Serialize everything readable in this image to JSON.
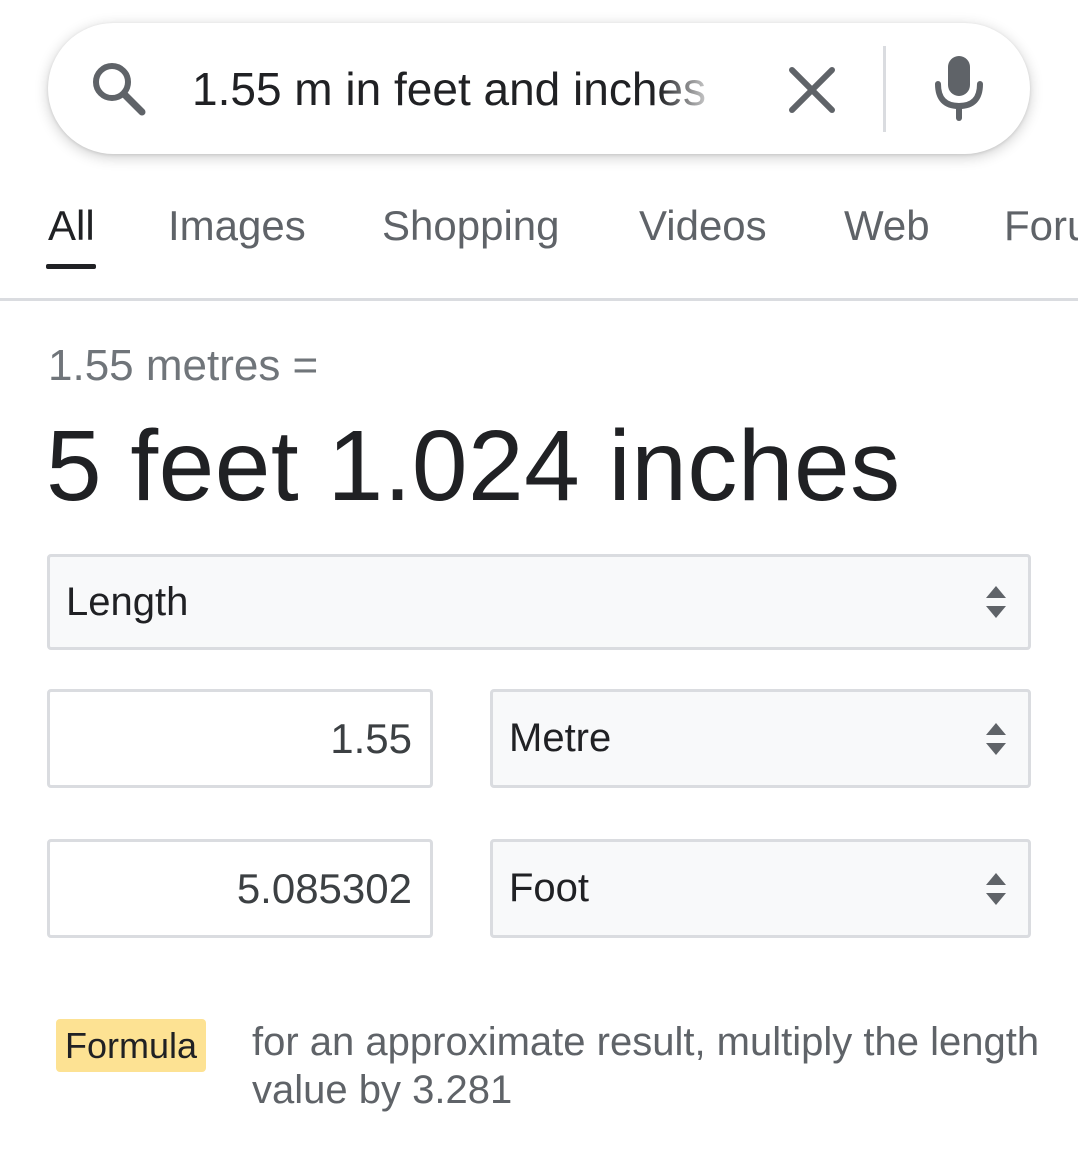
{
  "search": {
    "query": "1.55 m in feet and inches",
    "search_icon": "search-icon",
    "clear_icon": "close-icon",
    "voice_icon": "microphone-icon"
  },
  "tabs": [
    {
      "label": "All",
      "active": true
    },
    {
      "label": "Images",
      "active": false
    },
    {
      "label": "Shopping",
      "active": false
    },
    {
      "label": "Videos",
      "active": false
    },
    {
      "label": "Web",
      "active": false
    },
    {
      "label": "Foru",
      "active": false
    }
  ],
  "result": {
    "prefix": "1.55 metres =",
    "answer": "5 feet 1.024 inches"
  },
  "converter": {
    "category": "Length",
    "from_value": "1.55",
    "from_unit": "Metre",
    "to_value": "5.085302",
    "to_unit": "Foot"
  },
  "formula": {
    "badge": "Formula",
    "text": "for an approximate result, multiply the length value by 3.281"
  },
  "colors": {
    "accent_text": "#202124",
    "muted_text": "#5f6368",
    "border": "#dadce0",
    "formula_badge": "#fde293",
    "select_bg": "#f8f9fa"
  }
}
